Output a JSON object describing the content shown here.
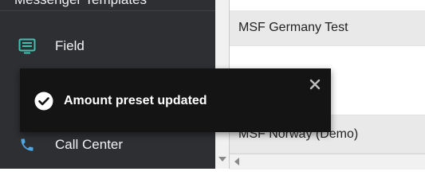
{
  "sidebar": {
    "header": "Messenger Templates",
    "items": [
      {
        "label": "Field",
        "icon": "field-list-icon",
        "icon_color": "#3fc1b0"
      },
      {
        "label": "Call Center",
        "icon": "phone-icon",
        "icon_color": "#4fa8e6"
      }
    ]
  },
  "main": {
    "rows": [
      {
        "text": "MSF Germany Test"
      },
      {
        "text": ""
      },
      {
        "text": "MSF Norway (Demo)"
      }
    ]
  },
  "toast": {
    "message": "Amount preset updated",
    "icon": "check-circle-icon",
    "close_icon": "close-icon"
  }
}
